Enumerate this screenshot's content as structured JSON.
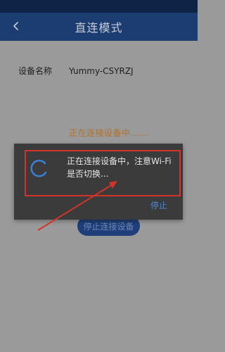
{
  "appbar": {
    "title": "直连模式",
    "back_icon": "chevron-left-icon"
  },
  "device": {
    "label": "设备名称",
    "value": "Yummy-CSYRZJ"
  },
  "status": {
    "text": "正在连接设备中......"
  },
  "background_button": {
    "label": "停止连接设备"
  },
  "dialog": {
    "message": "正在连接设备中，注意Wi-Fi是否切换...",
    "stop_label": "停止",
    "spinner_icon": "loading-spinner-icon"
  },
  "annotation": {
    "arrow_color": "#d2342b",
    "box_color": "#d2342b"
  }
}
